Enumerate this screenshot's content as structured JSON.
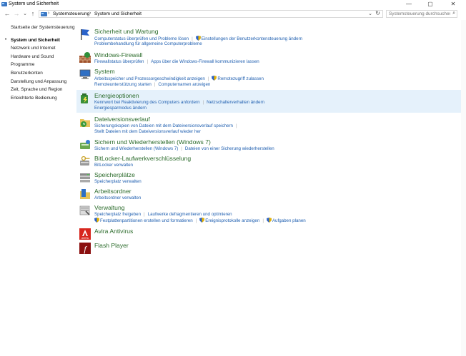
{
  "window": {
    "title": "System und Sicherheit"
  },
  "controls": {
    "minimize": "—",
    "maximize": "▢",
    "close": "✕"
  },
  "nav": {
    "back": "←",
    "forward": "→",
    "dropdown": "⌄",
    "up": "↑"
  },
  "address": {
    "crumbs": [
      "Systemsteuerung",
      "System und Sicherheit"
    ],
    "separator": "›",
    "dropdown": "⌄",
    "refresh": "↻"
  },
  "search": {
    "placeholder": "Systemsteuerung durchsuchen",
    "icon": "⌕"
  },
  "sidebar": {
    "items": [
      "Startseite der Systemsteuerung",
      "System und Sicherheit",
      "Netzwerk und Internet",
      "Hardware und Sound",
      "Programme",
      "Benutzerkonten",
      "Darstellung und Anpassung",
      "Zeit, Sprache und Region",
      "Erleichterte Bedienung"
    ],
    "current_index": 1,
    "bullet": "•"
  },
  "categories": [
    {
      "title": "Sicherheit und Wartung",
      "icon": "flag-icon",
      "lines": [
        [
          {
            "t": "Computerstatus überprüfen und Probleme lösen"
          },
          {
            "t": "Einstellungen der Benutzerkontensteuerung ändern",
            "shield": true
          }
        ],
        [
          {
            "t": "Problembehandlung für allgemeine Computerprobleme"
          }
        ]
      ]
    },
    {
      "title": "Windows-Firewall",
      "icon": "firewall-icon",
      "lines": [
        [
          {
            "t": "Firewallstatus überprüfen"
          },
          {
            "t": "Apps über die Windows-Firewall kommunizieren lassen"
          }
        ]
      ]
    },
    {
      "title": "System",
      "icon": "system-icon",
      "lines": [
        [
          {
            "t": "Arbeitsspeicher und Prozessorgeschwindigkeit anzeigen"
          },
          {
            "t": "Remotezugriff zulassen",
            "shield": true
          }
        ],
        [
          {
            "t": "Remoteunterstützung starten"
          },
          {
            "t": "Computernamen anzeigen"
          }
        ]
      ]
    },
    {
      "title": "Energieoptionen",
      "icon": "power-icon",
      "lines": [
        [
          {
            "t": "Kennwort bei Reaktivierung des Computers anfordern"
          },
          {
            "t": "Netzschalterverhalten ändern"
          }
        ],
        [
          {
            "t": "Energiesparmodus ändern"
          }
        ]
      ]
    },
    {
      "title": "Dateiversionsverlauf",
      "icon": "file-history-icon",
      "lines": [
        [
          {
            "t": "Sicherungskopien von Dateien mit dem Dateiversionsverlauf speichern"
          }
        ],
        [
          {
            "t": "Stellt Dateien mit dem Dateiversionsverlauf wieder her"
          }
        ]
      ]
    },
    {
      "title": "Sichern und Wiederherstellen (Windows 7)",
      "icon": "backup-icon",
      "lines": [
        [
          {
            "t": "Sichern und Wiederherstellen (Windows 7)"
          },
          {
            "t": "Dateien von einer Sicherung wiederherstellen"
          }
        ]
      ]
    },
    {
      "title": "BitLocker-Laufwerkverschlüsselung",
      "icon": "bitlocker-icon",
      "lines": [
        [
          {
            "t": "BitLocker verwalten"
          }
        ]
      ]
    },
    {
      "title": "Speicherplätze",
      "icon": "storage-spaces-icon",
      "lines": [
        [
          {
            "t": "Speicherplatz verwalten"
          }
        ]
      ]
    },
    {
      "title": "Arbeitsordner",
      "icon": "work-folders-icon",
      "lines": [
        [
          {
            "t": "Arbeitsordner verwalten"
          }
        ]
      ]
    },
    {
      "title": "Verwaltung",
      "icon": "admin-tools-icon",
      "lines": [
        [
          {
            "t": "Speicherplatz freigeben"
          },
          {
            "t": "Laufwerke defragmentieren und optimieren"
          }
        ],
        [
          {
            "t": "Festplattenpartitionen erstellen und formatieren",
            "shield": true
          },
          {
            "t": "Ereignisprotokolle anzeigen",
            "shield": true
          },
          {
            "t": "Aufgaben planen",
            "shield": true
          }
        ]
      ]
    },
    {
      "title": "Avira Antivirus",
      "icon": "avira-icon",
      "icon_label": "AVIRA",
      "lines": []
    },
    {
      "title": "Flash Player",
      "icon": "flash-icon",
      "icon_label": "f",
      "lines": []
    }
  ],
  "colors": {
    "category_title": "#2b6b2b",
    "link": "#1f5fb0",
    "highlight": "#e5f1fb"
  }
}
